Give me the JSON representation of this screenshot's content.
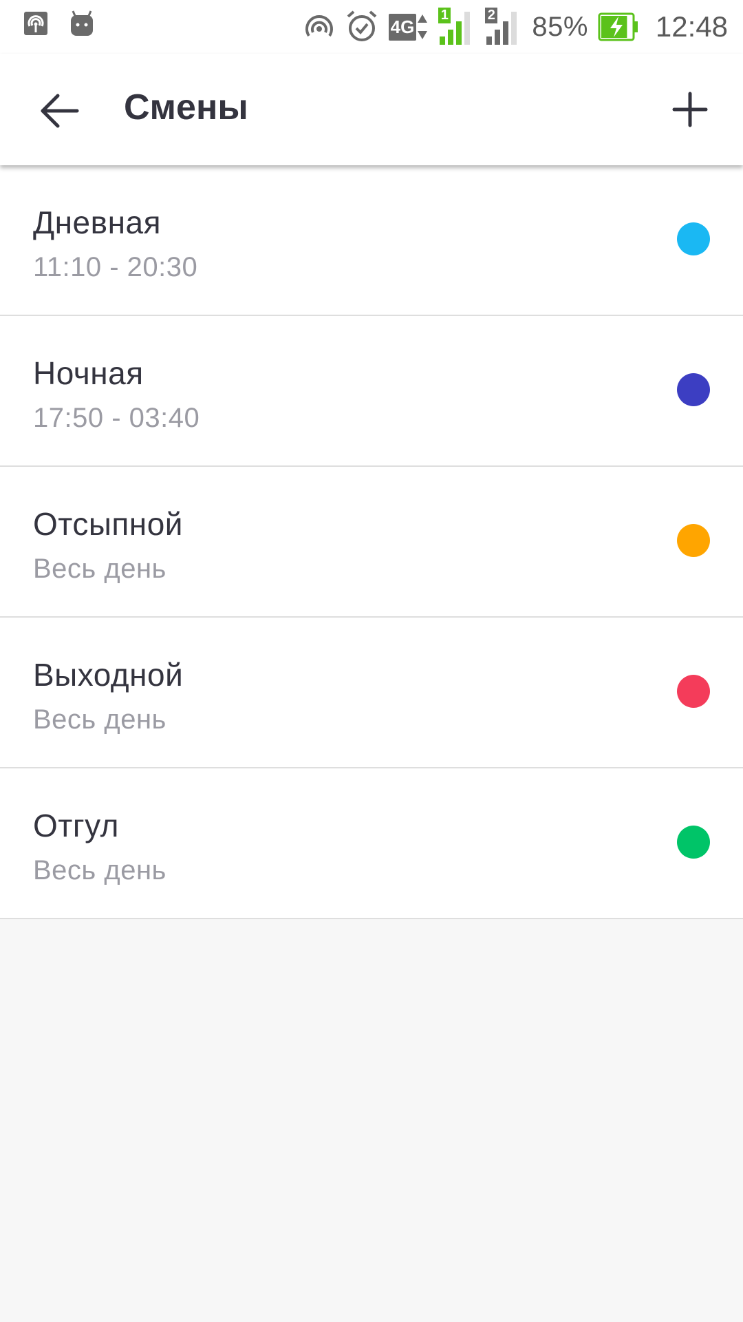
{
  "status_bar": {
    "left_icons": [
      "hotspot-icon",
      "android-icon"
    ],
    "right_icons": [
      "nfc-icon",
      "alarm-icon",
      "4g-icon",
      "signal-sim1-icon",
      "signal-sim2-icon"
    ],
    "network_label": "4G",
    "sim1_label": "1",
    "sim2_label": "2",
    "battery_percent": "85%",
    "time": "12:48",
    "battery_level": 0.85
  },
  "appbar": {
    "title": "Смены",
    "back_icon": "arrow-left-icon",
    "add_icon": "plus-icon"
  },
  "shifts": [
    {
      "name": "Дневная",
      "time": "11:10 - 20:30",
      "color": "#1ab8f3"
    },
    {
      "name": "Ночная",
      "time": "17:50 - 03:40",
      "color": "#3c3ec2"
    },
    {
      "name": "Отсыпной",
      "time": "Весь день",
      "color": "#ffa500"
    },
    {
      "name": "Выходной",
      "time": "Весь день",
      "color": "#f43c5a"
    },
    {
      "name": "Отгул",
      "time": "Весь день",
      "color": "#00c468"
    }
  ],
  "colors": {
    "text_primary": "#34343f",
    "text_secondary": "#9b9ba3",
    "background": "#f7f7f7",
    "accent_battery": "#5bc21b"
  }
}
